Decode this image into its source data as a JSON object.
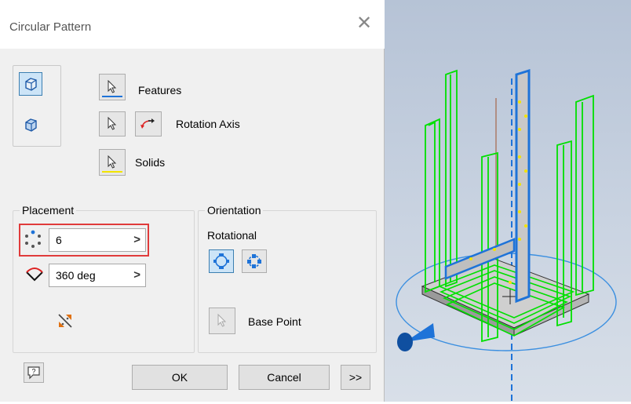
{
  "dialog": {
    "title": "Circular Pattern",
    "selectors": {
      "features_label": "Features",
      "rotation_axis_label": "Rotation Axis",
      "solids_label": "Solids"
    },
    "placement": {
      "legend": "Placement",
      "count_value": "6",
      "angle_value": "360 deg"
    },
    "orientation": {
      "legend": "Orientation",
      "mode_label": "Rotational",
      "base_point_label": "Base Point"
    },
    "footer": {
      "ok_label": "OK",
      "cancel_label": "Cancel",
      "more_label": ">>"
    }
  },
  "colors": {
    "highlight_red": "#e03b3b",
    "selection_blue": "#1e73d8",
    "solids_yellow": "#f2e400",
    "preview_green": "#00e000"
  }
}
